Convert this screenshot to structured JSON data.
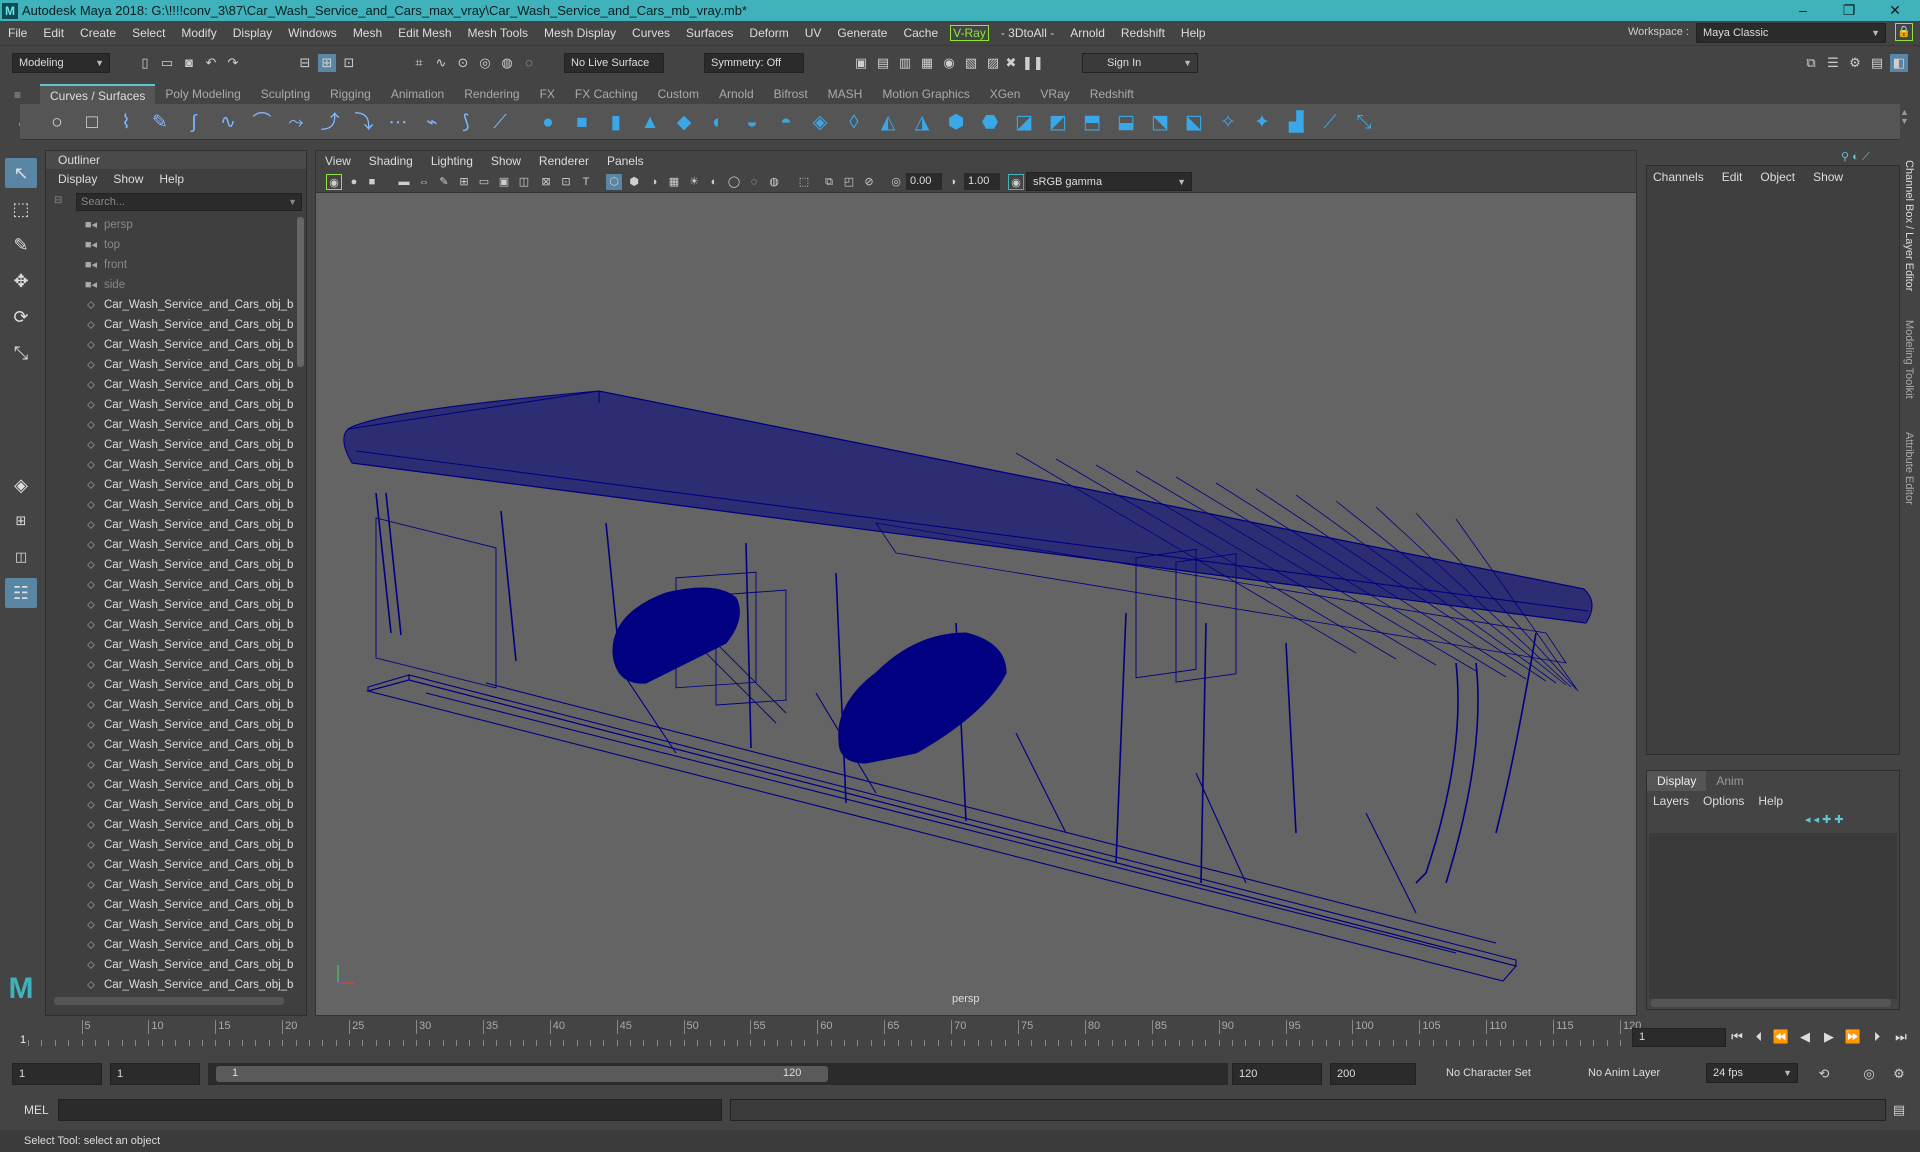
{
  "window": {
    "title": "Autodesk Maya 2018: G:\\!!!!conv_3\\87\\Car_Wash_Service_and_Cars_max_vray\\Car_Wash_Service_and_Cars_mb_vray.mb*",
    "minimize": "–",
    "restore": "❐",
    "close": "✕"
  },
  "menus": [
    "File",
    "Edit",
    "Create",
    "Select",
    "Modify",
    "Display",
    "Windows",
    "Mesh",
    "Edit Mesh",
    "Mesh Tools",
    "Mesh Display",
    "Curves",
    "Surfaces",
    "Deform",
    "UV",
    "Generate",
    "Cache",
    "V-Ray",
    "- 3DtoAll -",
    "Arnold",
    "Redshift",
    "Help"
  ],
  "workspace": {
    "label": "Workspace :",
    "value": "Maya Classic"
  },
  "status": {
    "mode": "Modeling",
    "live_surface": "No Live Surface",
    "symmetry": "Symmetry: Off",
    "sign_in": "Sign In"
  },
  "shelf_tabs": [
    "Curves / Surfaces",
    "Poly Modeling",
    "Sculpting",
    "Rigging",
    "Animation",
    "Rendering",
    "FX",
    "FX Caching",
    "Custom",
    "Arnold",
    "Bifrost",
    "MASH",
    "Motion Graphics",
    "XGen",
    "VRay",
    "Redshift"
  ],
  "outliner": {
    "title": "Outliner",
    "menu": [
      "Display",
      "Show",
      "Help"
    ],
    "search_placeholder": "Search...",
    "cameras": [
      "persp",
      "top",
      "front",
      "side"
    ],
    "item_label": "Car_Wash_Service_and_Cars_obj_base",
    "item_count": 35
  },
  "viewport": {
    "menu": [
      "View",
      "Shading",
      "Lighting",
      "Show",
      "Renderer",
      "Panels"
    ],
    "exposure": "0.00",
    "gamma": "1.00",
    "color_space": "sRGB gamma",
    "camera": "persp"
  },
  "channel_box": {
    "menu": [
      "Channels",
      "Edit",
      "Object",
      "Show"
    ]
  },
  "layer_editor": {
    "tabs": [
      "Display",
      "Anim"
    ],
    "menu": [
      "Layers",
      "Options",
      "Help"
    ]
  },
  "side_tabs": [
    "Channel Box / Layer Editor",
    "Modeling Toolkit",
    "Attribute Editor"
  ],
  "timeline": {
    "ticks": [
      5,
      10,
      15,
      20,
      25,
      30,
      35,
      40,
      45,
      50,
      55,
      60,
      65,
      70,
      75,
      80,
      85,
      90,
      95,
      100,
      105,
      110,
      115,
      120
    ],
    "current": "1",
    "current_field": "1"
  },
  "range": {
    "start": "1",
    "start2": "1",
    "slider_start": "1",
    "slider_end": "120",
    "end": "120",
    "end2": "200",
    "character_set": "No Character Set",
    "anim_layer": "No Anim Layer",
    "fps": "24 fps"
  },
  "command": {
    "label": "MEL"
  },
  "help_line": "Select Tool: select an object",
  "colors": {
    "title_bar": "#3fb2bb",
    "wire": "#000080",
    "viewport_bg": "#646464",
    "vray": "#8ce63b"
  }
}
